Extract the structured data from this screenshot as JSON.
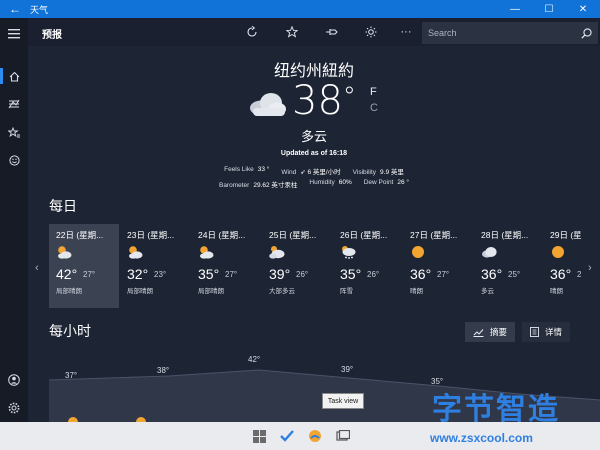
{
  "window": {
    "title": "天气"
  },
  "header": {
    "title": "预报"
  },
  "search": {
    "placeholder": "Search"
  },
  "current": {
    "location": "纽约州紐約",
    "temperature": "38",
    "degree_symbol": "°",
    "unit_f": "F",
    "unit_c": "C",
    "condition": "多云",
    "updated": "Updated as of 16:18",
    "details_row1": [
      {
        "label": "Feels Like",
        "value": "33 °"
      },
      {
        "label": "Wind",
        "value": "➶ 6 英里/小时"
      },
      {
        "label": "Visibility",
        "value": "9.9 英里"
      }
    ],
    "details_row2": [
      {
        "label": "Barometer",
        "value": "29.62 英寸汞柱"
      },
      {
        "label": "Humidity",
        "value": "60%"
      },
      {
        "label": "Dew Point",
        "value": "26 °"
      }
    ]
  },
  "daily": {
    "title": "每日",
    "days": [
      {
        "date": "22日 (星期...",
        "high": "42°",
        "low": "27°",
        "desc": "局部晴朗",
        "icon": "partly-sunny-icon"
      },
      {
        "date": "23日 (星期...",
        "high": "32°",
        "low": "23°",
        "desc": "局部晴朗",
        "icon": "partly-sunny-icon"
      },
      {
        "date": "24日 (星期...",
        "high": "35°",
        "low": "27°",
        "desc": "局部晴朗",
        "icon": "partly-sunny-icon"
      },
      {
        "date": "25日 (星期...",
        "high": "39°",
        "low": "26°",
        "desc": "大部多云",
        "icon": "mostly-cloudy-icon"
      },
      {
        "date": "26日 (星期...",
        "high": "35°",
        "low": "26°",
        "desc": "阵雪",
        "icon": "snow-showers-icon"
      },
      {
        "date": "27日 (星期...",
        "high": "36°",
        "low": "27°",
        "desc": "晴朗",
        "icon": "sunny-icon"
      },
      {
        "date": "28日 (星期...",
        "high": "36°",
        "low": "25°",
        "desc": "多云",
        "icon": "cloudy-icon"
      },
      {
        "date": "29日 (星",
        "high": "36°",
        "low": "2",
        "desc": "晴朗",
        "icon": "sunny-icon"
      }
    ]
  },
  "hourly": {
    "title": "每小时",
    "summary_label": "摘要",
    "details_label": "详情",
    "temps": [
      "37°",
      "38°",
      "42°",
      "39°",
      "35°"
    ]
  },
  "tooltip": "Task view",
  "watermark": {
    "cn": "字节智造",
    "url": "www.zsxcool.com"
  },
  "colors": {
    "accent": "#1172d8",
    "background": "#1d2433",
    "selected_day": "#3b4252"
  }
}
